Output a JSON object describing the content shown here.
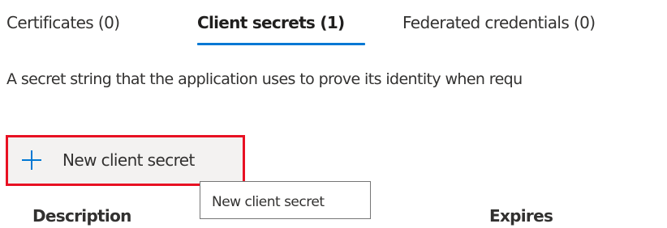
{
  "tabs": [
    {
      "label": "Certificates (0)",
      "selected": false
    },
    {
      "label": "Client secrets (1)",
      "selected": true
    },
    {
      "label": "Federated credentials (0)",
      "selected": false
    }
  ],
  "description": "A secret string that the application uses to prove its identity when requ",
  "toolbar": {
    "new_secret_label": "New client secret",
    "new_secret_icon": "plus-icon"
  },
  "tooltip": {
    "text": "New client secret"
  },
  "table": {
    "columns": [
      "Description",
      "Expires"
    ]
  },
  "colors": {
    "accent": "#0078d4",
    "highlight_border": "#e81123",
    "button_background": "#f3f2f1"
  }
}
